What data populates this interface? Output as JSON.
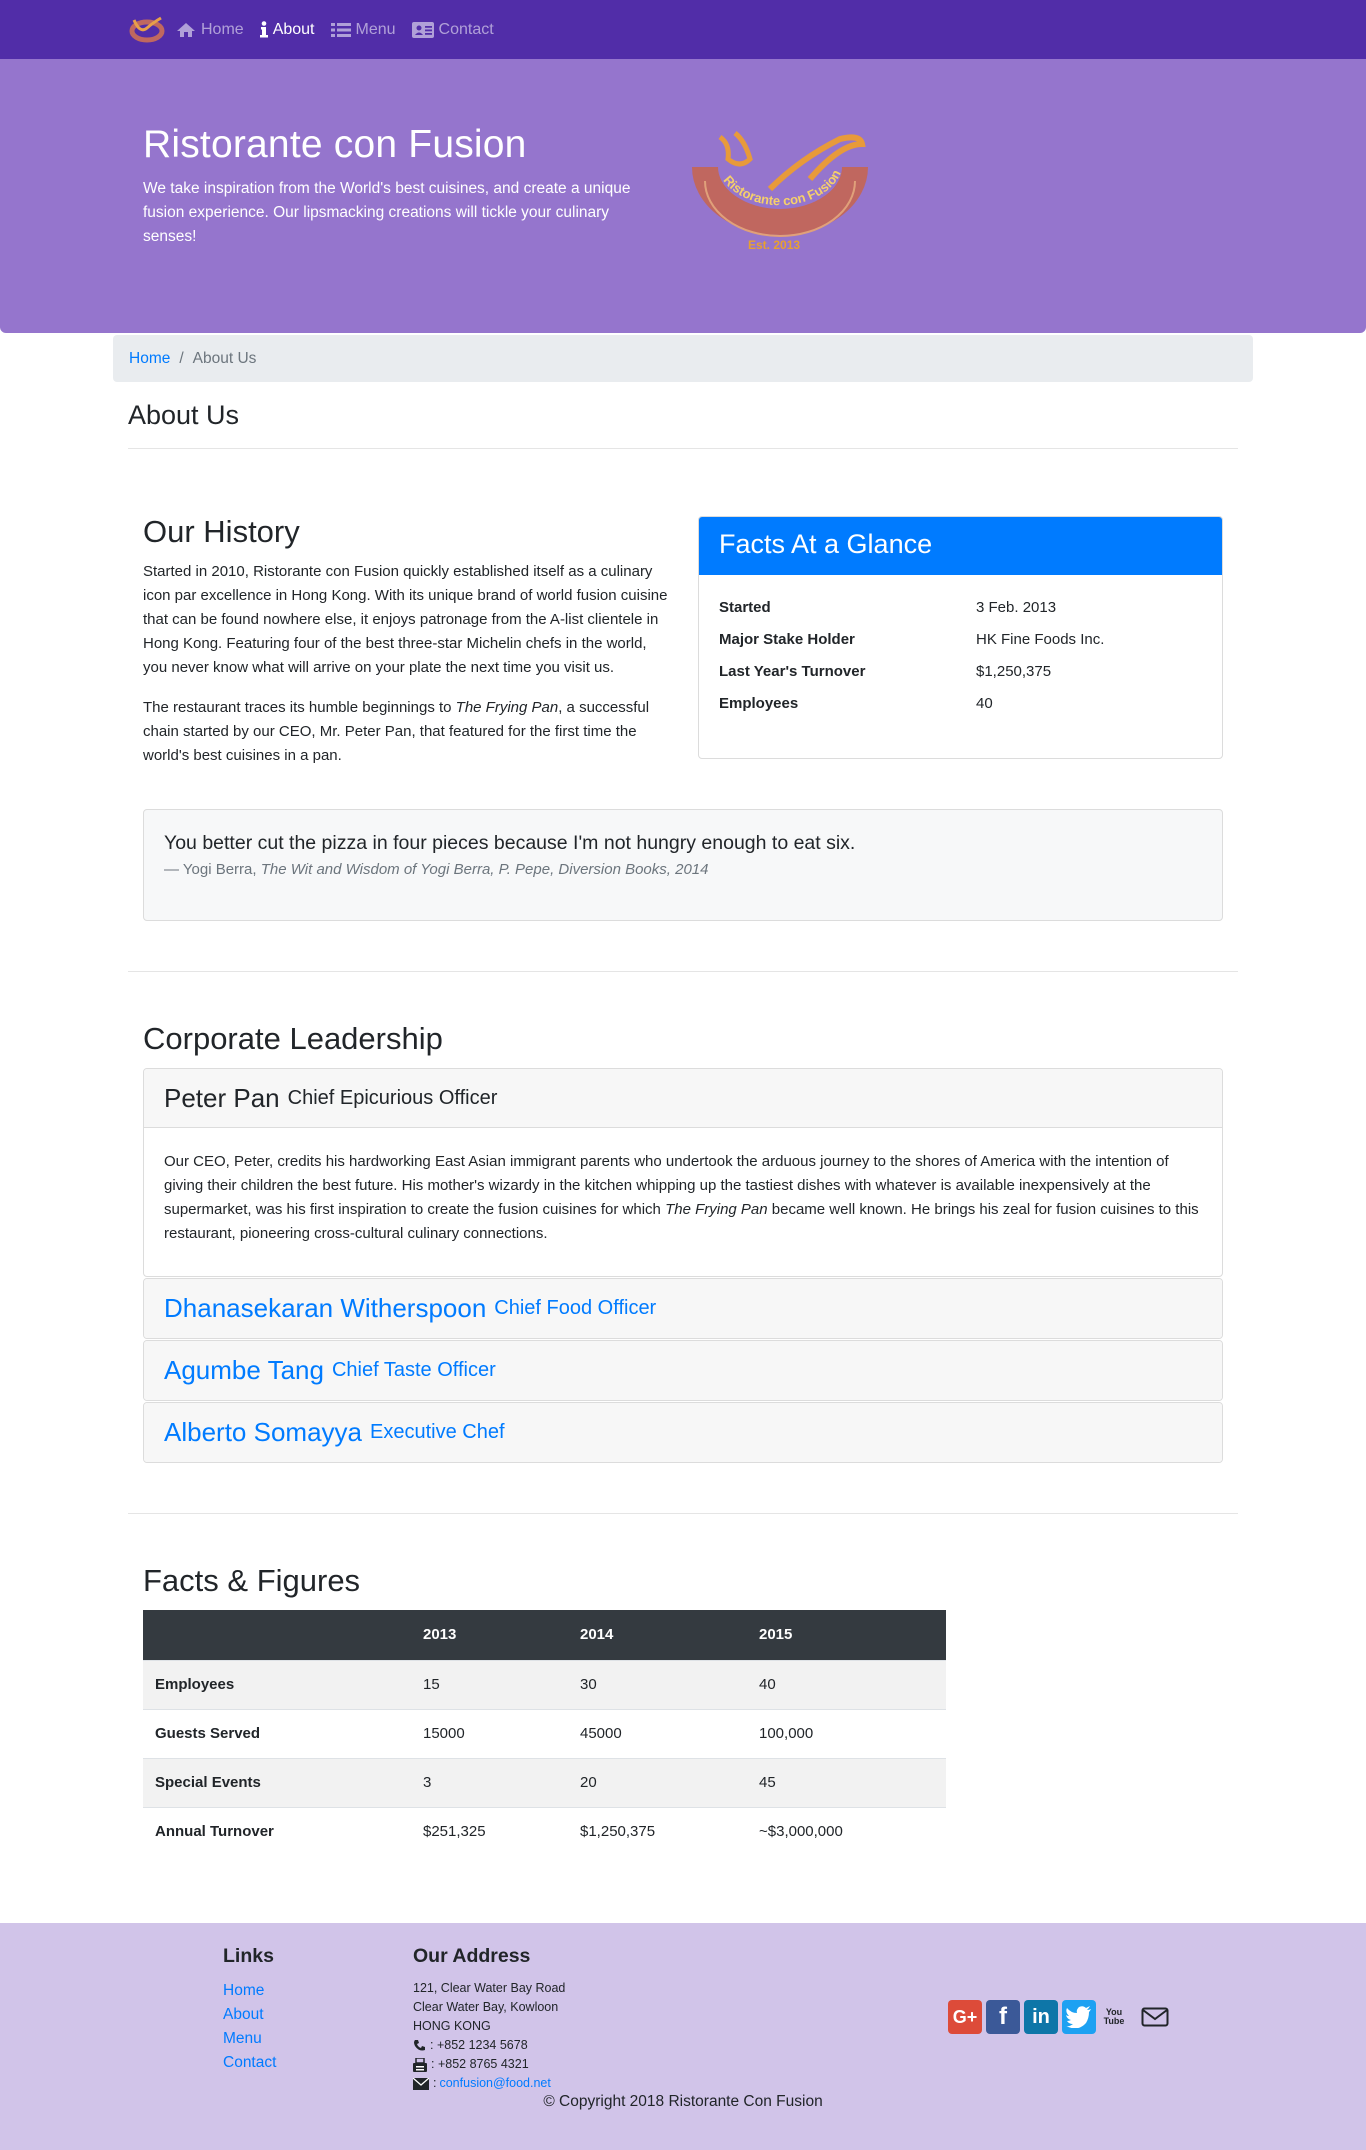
{
  "nav": {
    "items": [
      {
        "label": "Home",
        "icon": "home-icon"
      },
      {
        "label": "About",
        "icon": "info-icon",
        "active": true
      },
      {
        "label": "Menu",
        "icon": "list-icon"
      },
      {
        "label": "Contact",
        "icon": "address-card-icon"
      }
    ],
    "brand_color": "#512da8"
  },
  "jumbotron": {
    "title": "Ristorante con Fusion",
    "text": "We take inspiration from the World's best cuisines, and create a unique fusion experience. Our lipsmacking creations will tickle your culinary senses!",
    "logo_text": "Ristorante con Fusion",
    "logo_est": "Est. 2013",
    "bg_color": "#9575cd"
  },
  "breadcrumb": {
    "home": "Home",
    "sep": "/",
    "current": "About Us"
  },
  "page_title": "About Us",
  "history": {
    "title": "Our History",
    "p1": "Started in 2010, Ristorante con Fusion quickly established itself as a culinary icon par excellence in Hong Kong. With its unique brand of world fusion cuisine that can be found nowhere else, it enjoys patronage from the A-list clientele in Hong Kong. Featuring four of the best three-star Michelin chefs in the world, you never know what will arrive on your plate the next time you visit us.",
    "p2_pre": "The restaurant traces its humble beginnings to ",
    "p2_em": "The Frying Pan",
    "p2_post": ", a successful chain started by our CEO, Mr. Peter Pan, that featured for the first time the world's best cuisines in a pan."
  },
  "facts": {
    "title": "Facts At a Glance",
    "rows": [
      {
        "label": "Started",
        "value": "3 Feb. 2013"
      },
      {
        "label": "Major Stake Holder",
        "value": "HK Fine Foods Inc."
      },
      {
        "label": "Last Year's Turnover",
        "value": "$1,250,375"
      },
      {
        "label": "Employees",
        "value": "40"
      }
    ]
  },
  "quote": {
    "text": "You better cut the pizza in four pieces because I'm not hungry enough to eat six.",
    "author": "— Yogi Berra,",
    "cite": "The Wit and Wisdom of Yogi Berra, P. Pepe, Diversion Books, 2014"
  },
  "leadership": {
    "title": "Corporate Leadership",
    "leaders": [
      {
        "name": "Peter Pan",
        "role": "Chief Epicurious Officer",
        "bio_pre": "Our CEO, Peter, credits his hardworking East Asian immigrant parents who undertook the arduous journey to the shores of America with the intention of giving their children the best future. His mother's wizardy in the kitchen whipping up the tastiest dishes with whatever is available inexpensively at the supermarket, was his first inspiration to create the fusion cuisines for which ",
        "bio_em": "The Frying Pan",
        "bio_post": " became well known. He brings his zeal for fusion cuisines to this restaurant, pioneering cross-cultural culinary connections."
      },
      {
        "name": "Dhanasekaran Witherspoon",
        "role": "Chief Food Officer"
      },
      {
        "name": "Agumbe Tang",
        "role": "Chief Taste Officer"
      },
      {
        "name": "Alberto Somayya",
        "role": "Executive Chef"
      }
    ]
  },
  "figures": {
    "title": "Facts & Figures",
    "headers": [
      "",
      "2013",
      "2014",
      "2015"
    ],
    "rows": [
      [
        "Employees",
        "15",
        "30",
        "40"
      ],
      [
        "Guests Served",
        "15000",
        "45000",
        "100,000"
      ],
      [
        "Special Events",
        "3",
        "20",
        "45"
      ],
      [
        "Annual Turnover",
        "$251,325",
        "$1,250,375",
        "~$3,000,000"
      ]
    ]
  },
  "footer": {
    "links_title": "Links",
    "links": [
      "Home",
      "About",
      "Menu",
      "Contact"
    ],
    "address_title": "Our Address",
    "address_lines": [
      "121, Clear Water Bay Road",
      "Clear Water Bay, Kowloon",
      "HONG KONG"
    ],
    "phone": ": +852 1234 5678",
    "fax": ": +852 8765 4321",
    "email": "confusion@food.net",
    "email_prefix": ":",
    "socials": [
      {
        "icon": "google-plus-icon",
        "glyph": "G+",
        "color": "#dd4b39"
      },
      {
        "icon": "facebook-icon",
        "glyph": "f",
        "color": "#3b5998"
      },
      {
        "icon": "linkedin-icon",
        "glyph": "in",
        "color": "#0e76a8"
      },
      {
        "icon": "twitter-icon",
        "glyph": "t",
        "color": "#1da1f2"
      },
      {
        "icon": "youtube-icon",
        "glyph": "You Tube",
        "color": "#212529"
      },
      {
        "icon": "mail-icon",
        "glyph": "",
        "color": "#212529"
      }
    ],
    "copyright": "© Copyright 2018 Ristorante Con Fusion",
    "bg_color": "#d1c4e9"
  }
}
